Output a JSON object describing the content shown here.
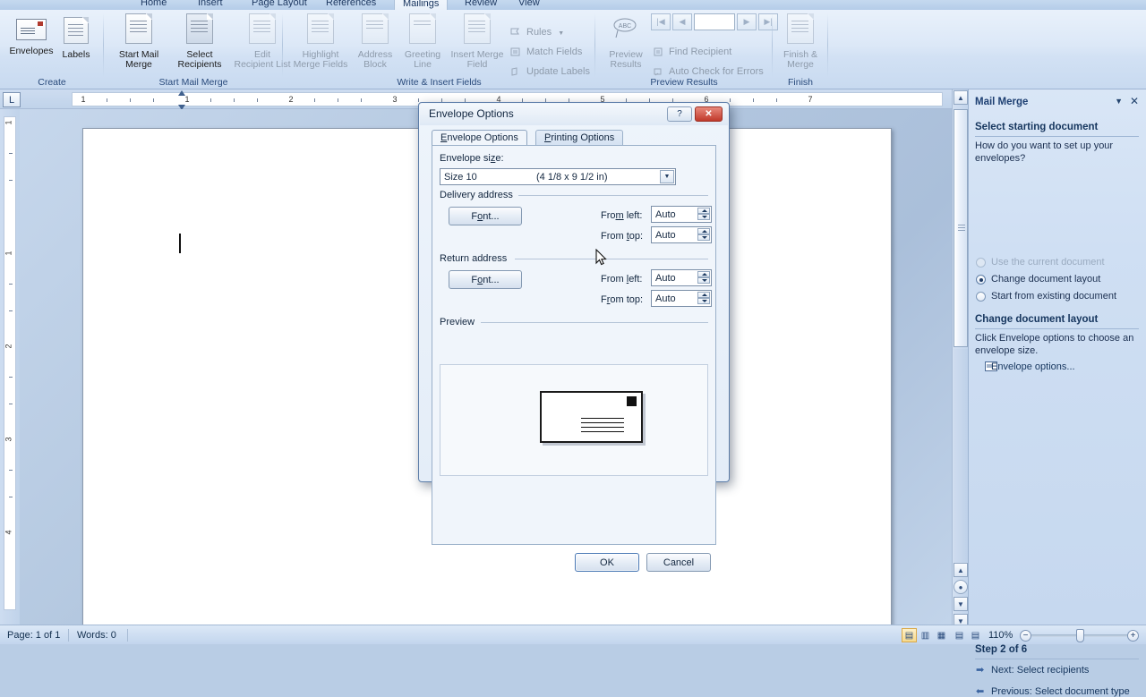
{
  "ribbon": {
    "tabs": [
      {
        "label": "Home",
        "active": false
      },
      {
        "label": "Insert",
        "active": false
      },
      {
        "label": "Page Layout",
        "active": false
      },
      {
        "label": "References",
        "active": false
      },
      {
        "label": "Mailings",
        "active": true
      },
      {
        "label": "Review",
        "active": false
      },
      {
        "label": "View",
        "active": false
      }
    ],
    "groups": [
      {
        "name": "Create",
        "label": "Create",
        "buttons": [
          {
            "label": "Envelopes",
            "icon": "envelope-icon"
          },
          {
            "label": "Labels",
            "icon": "labels-icon"
          }
        ]
      },
      {
        "name": "Start Mail Merge",
        "label": "Start Mail Merge",
        "buttons": [
          {
            "label": "Start Mail\nMerge",
            "icon": "start-mail-merge-icon",
            "dropdown": true
          },
          {
            "label": "Select\nRecipients",
            "icon": "select-recipients-icon",
            "dropdown": true
          },
          {
            "label": "Edit\nRecipient List",
            "icon": "edit-recipient-list-icon",
            "dropdown": false
          }
        ]
      },
      {
        "name": "Write & Insert Fields",
        "label": "Write & Insert Fields",
        "buttons": [
          {
            "label": "Highlight\nMerge Fields",
            "icon": "highlight-merge-fields-icon"
          },
          {
            "label": "Address\nBlock",
            "icon": "address-block-icon"
          },
          {
            "label": "Greeting\nLine",
            "icon": "greeting-line-icon"
          },
          {
            "label": "Insert Merge\nField",
            "icon": "insert-merge-field-icon",
            "dropdown": true
          }
        ],
        "small": [
          {
            "label": "Rules",
            "icon": "rules-icon",
            "dropdown": true,
            "disabled": true
          },
          {
            "label": "Match Fields",
            "icon": "match-fields-icon",
            "disabled": true
          },
          {
            "label": "Update Labels",
            "icon": "update-labels-icon",
            "disabled": true
          }
        ]
      },
      {
        "name": "Preview Results",
        "label": "Preview Results",
        "buttons": [
          {
            "label": "Preview\nResults",
            "icon": "preview-results-icon"
          }
        ],
        "small": [
          {
            "label": "Find Recipient",
            "icon": "find-recipient-icon",
            "disabled": true
          },
          {
            "label": "Auto Check for Errors",
            "icon": "auto-check-errors-icon",
            "disabled": true
          }
        ],
        "nav": {
          "first": "first-record-icon",
          "prev": "previous-record-icon",
          "value": "",
          "next": "next-record-icon",
          "last": "last-record-icon"
        }
      },
      {
        "name": "Finish",
        "label": "Finish",
        "buttons": [
          {
            "label": "Finish &\nMerge",
            "icon": "finish-merge-icon",
            "dropdown": true
          }
        ]
      }
    ]
  },
  "ruler": {
    "tab_selector": "L",
    "h_numbers": [
      "1",
      "1",
      "2",
      "3",
      "4",
      "5",
      "6",
      "7"
    ],
    "v_numbers": [
      "1",
      "1",
      "2",
      "3",
      "4"
    ]
  },
  "dialog": {
    "title": "Envelope Options",
    "help_label": "?",
    "close_label": "✕",
    "tabs": [
      {
        "label": "Envelope Options",
        "active": true
      },
      {
        "label": "Printing Options",
        "active": false
      }
    ],
    "envelope_size_label": "Envelope size:",
    "envelope_size_value": "Size 10",
    "envelope_size_dimensions": "(4 1/8 x 9 1/2 in)",
    "dropdown_icon": "chevron-down-icon",
    "delivery": {
      "group_label": "Delivery address",
      "font_button": "Font...",
      "from_left_label": "From left:",
      "from_left_value": "Auto",
      "from_top_label": "From top:",
      "from_top_value": "Auto"
    },
    "return": {
      "group_label": "Return address",
      "font_button": "Font...",
      "from_left_label": "From left:",
      "from_left_value": "Auto",
      "from_top_label": "From top:",
      "from_top_value": "Auto"
    },
    "preview_label": "Preview",
    "preview_icon": "envelope-preview-icon",
    "ok_label": "OK",
    "cancel_label": "Cancel"
  },
  "pane": {
    "title": "Mail Merge",
    "menu_icon": "chevron-down-icon",
    "close_icon": "close-icon",
    "section1_heading": "Select starting document",
    "question": "How do you want to set up your envelopes?",
    "options": [
      {
        "label": "Use the current document",
        "selected": false,
        "disabled": true
      },
      {
        "label": "Change document layout",
        "selected": true,
        "disabled": false
      },
      {
        "label": "Start from existing document",
        "selected": false,
        "disabled": false
      }
    ],
    "section2_heading": "Change document layout",
    "section2_text": "Click Envelope options to choose an envelope size.",
    "envelope_options_link": "Envelope options...",
    "envelope_options_icon": "envelope-icon",
    "step_heading": "Step 2 of 6",
    "next_label": "Next: Select recipients",
    "next_icon": "arrow-right-icon",
    "previous_label": "Previous: Select document type",
    "previous_icon": "arrow-left-icon"
  },
  "status": {
    "page": "Page: 1 of 1",
    "words": "Words: 0",
    "view_buttons": [
      {
        "name": "print-layout-view",
        "selected": true
      },
      {
        "name": "full-screen-reading-view",
        "selected": false
      },
      {
        "name": "web-layout-view",
        "selected": false
      },
      {
        "name": "outline-view",
        "selected": false
      },
      {
        "name": "draft-view",
        "selected": false
      }
    ],
    "zoom": "110%",
    "zoom_out_icon": "minus-icon",
    "zoom_in_icon": "plus-icon"
  },
  "colors": {
    "accent": "#1d3f72",
    "close_red": "#c0392b",
    "ribbon_bg": "#dce8f7",
    "pane_bg": "#cfdff3"
  }
}
